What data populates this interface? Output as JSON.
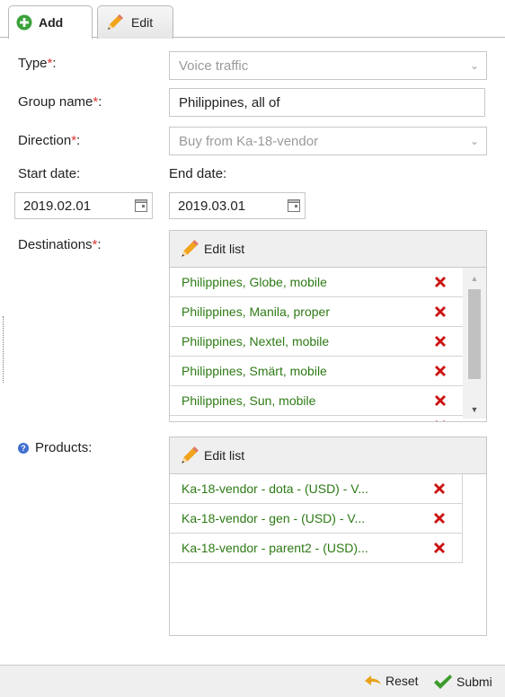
{
  "tabs": [
    {
      "label": "Add",
      "icon": "plus-circle-icon"
    },
    {
      "label": "Edit",
      "icon": "pencil-icon"
    }
  ],
  "form": {
    "type": {
      "label": "Type",
      "required_mark": "*",
      "value": "Voice traffic"
    },
    "group_name": {
      "label": "Group name",
      "required_mark": "*",
      "value": "Philippines, all of"
    },
    "direction": {
      "label": "Direction",
      "required_mark": "*",
      "value": "Buy from Ka-18-vendor"
    },
    "start_date": {
      "label": "Start date:",
      "value": "2019.02.01"
    },
    "end_date": {
      "label": "End date:",
      "value": "2019.03.01"
    },
    "destinations": {
      "label": "Destinations",
      "required_mark": "*",
      "edit_label": "Edit list",
      "items": [
        "Philippines, Globe, mobile",
        "Philippines, Manila, proper",
        "Philippines, Nextel, mobile",
        "Philippines, Smärt, mobile",
        "Philippines, Sun, mobile"
      ]
    },
    "products": {
      "label": "Products:",
      "help_icon": "?",
      "edit_label": "Edit list",
      "items": [
        "Ka-18-vendor - dota - (USD) - V...",
        "Ka-18-vendor - gen - (USD) - V...",
        "Ka-18-vendor - parent2 - (USD)..."
      ]
    }
  },
  "footer": {
    "reset_label": "Reset",
    "submit_label": "Submi"
  },
  "colors": {
    "accent_green": "#2d7a14",
    "required_red": "#e0332f",
    "delete_red": "#cc1111"
  }
}
